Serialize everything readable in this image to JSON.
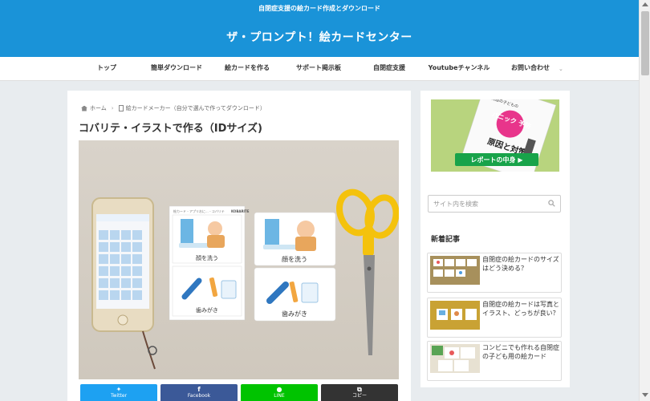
{
  "header": {
    "tagline": "自閉症支援の絵カード作成とダウンロード",
    "site_title": "ザ・プロンプト！絵カードセンター",
    "bg_color": "#1a93d8"
  },
  "nav": {
    "items": [
      {
        "label": "トップ"
      },
      {
        "label": "簡単ダウンロード"
      },
      {
        "label": "絵カードを作る"
      },
      {
        "label": "サポート掲示板"
      },
      {
        "label": "自閉症支援"
      },
      {
        "label": "Youtubeチャンネル"
      },
      {
        "label": "お問い合わせ"
      }
    ],
    "more_arrow": "⌄"
  },
  "breadcrumb": {
    "home": "ホーム",
    "separator": "›",
    "category": "絵カードメーカー（自分で選んで作ってダウンロード）"
  },
  "article": {
    "title": "コバリテ・イラストで作る（IDサイズ)",
    "cards": [
      {
        "caption": "顔を洗う"
      },
      {
        "caption": "顔を洗う"
      },
      {
        "caption": "歯みがき"
      },
      {
        "caption": "歯みがき"
      }
    ],
    "sheet_header": "絵カード - アプリおに... - コバリテ",
    "sheet_logo": "KOBARITE"
  },
  "share": [
    {
      "label": "Twitter",
      "icon": "✦",
      "icon_name": "twitter-icon",
      "color": "#1da1f2"
    },
    {
      "label": "Facebook",
      "icon": "f",
      "icon_name": "facebook-icon",
      "color": "#3b5998"
    },
    {
      "label": "LINE",
      "icon": "●",
      "icon_name": "line-icon",
      "color": "#00c300"
    },
    {
      "label": "コピー",
      "icon": "⧉",
      "icon_name": "copy-icon",
      "color": "#333333"
    }
  ],
  "sidebar": {
    "banner": {
      "doc_heading": "パニック 予防",
      "doc_title": "原因と対策",
      "doc_side": "自閉症の子どもの",
      "cta": "レポートの中身 ▶"
    },
    "search_placeholder": "サイト内を検索",
    "recent_heading": "新着記事",
    "recent": [
      {
        "title": "自閉症の絵カードのサイズはどう決める？"
      },
      {
        "title": "自閉症の絵カードは写真とイラスト、どっちが良い？"
      },
      {
        "title": "コンビニでも作れる自閉症の子ども用の絵カード"
      }
    ]
  }
}
